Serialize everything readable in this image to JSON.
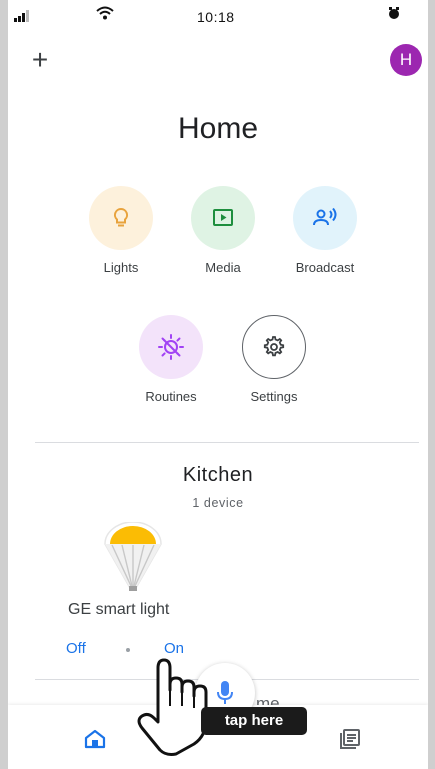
{
  "status_bar": {
    "time": "10:18"
  },
  "header": {
    "add_label": "+",
    "avatar_initial": "H",
    "avatar_color": "#9c27b0",
    "title": "Home"
  },
  "shortcuts": [
    {
      "label": "Lights",
      "icon": "lightbulb-icon",
      "bg": "#fdf1dc"
    },
    {
      "label": "Media",
      "icon": "play-icon",
      "bg": "#dff3e4"
    },
    {
      "label": "Broadcast",
      "icon": "broadcast-icon",
      "bg": "#e1f3fb"
    },
    {
      "label": "Routines",
      "icon": "routines-icon",
      "bg": "#f3e3fa"
    },
    {
      "label": "Settings",
      "icon": "gear-icon",
      "bg": "#ffffff"
    }
  ],
  "room": {
    "title": "Kitchen",
    "count": "1 device",
    "device": {
      "name": "GE smart light",
      "off_label": "Off",
      "on_label": "On"
    }
  },
  "next_room": {
    "title": "me"
  },
  "overlay": {
    "hint": "tap here"
  },
  "nav": {
    "home_icon": "home-icon",
    "feed_icon": "feed-icon",
    "mic_icon": "mic-icon"
  },
  "colors": {
    "accent": "#1a73e8"
  }
}
